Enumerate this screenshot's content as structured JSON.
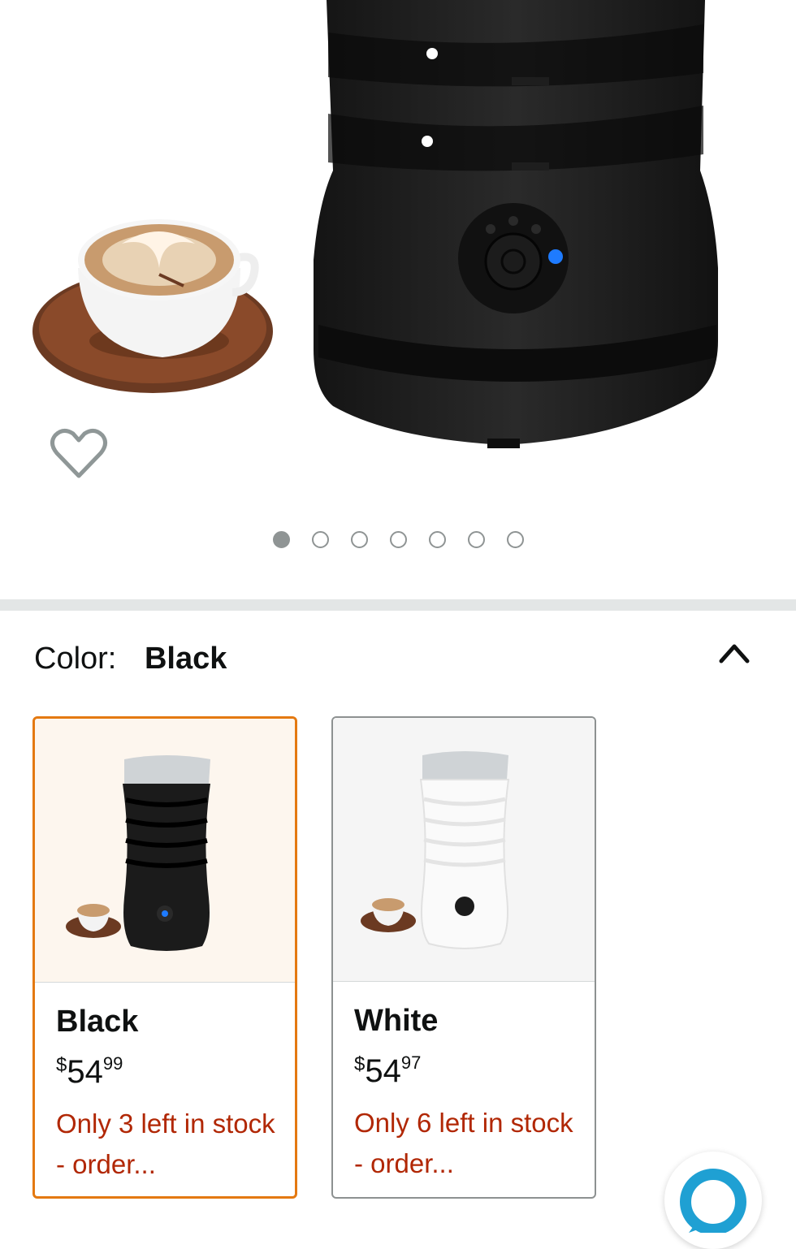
{
  "gallery": {
    "dot_count": 7,
    "active_index": 0
  },
  "color_selector": {
    "label": "Color:",
    "selected": "Black"
  },
  "options": [
    {
      "name": "Black",
      "currency": "$",
      "price_whole": "54",
      "price_fraction": "99",
      "stock": "Only 3 left in stock - order..."
    },
    {
      "name": "White",
      "currency": "$",
      "price_whole": "54",
      "price_fraction": "97",
      "stock": "Only 6 left in stock - order..."
    }
  ],
  "colors": {
    "selected_border": "#e47911",
    "stock_text": "#b12704",
    "alexa_ring": "#1fa0d3"
  },
  "icons": [
    "heart-icon",
    "chevron-up-icon",
    "alexa-icon"
  ]
}
